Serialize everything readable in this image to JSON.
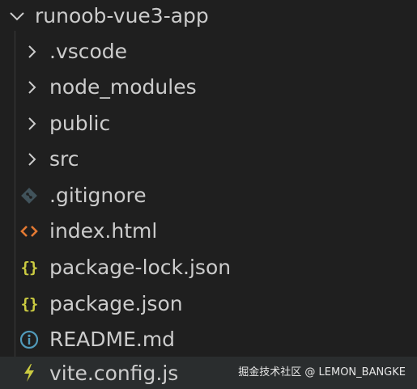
{
  "explorer": {
    "root": {
      "label": "runoob-vue3-app",
      "icon": "chevron-down-icon"
    },
    "items": [
      {
        "label": ".vscode",
        "kind": "folder",
        "icon": "chevron-right-icon"
      },
      {
        "label": "node_modules",
        "kind": "folder",
        "icon": "chevron-right-icon"
      },
      {
        "label": "public",
        "kind": "folder",
        "icon": "chevron-right-icon"
      },
      {
        "label": "src",
        "kind": "folder",
        "icon": "chevron-right-icon"
      },
      {
        "label": ".gitignore",
        "kind": "file",
        "icon": "git-icon",
        "icon_color": "#41535b"
      },
      {
        "label": "index.html",
        "kind": "file",
        "icon": "html-icon",
        "icon_color": "#e37933"
      },
      {
        "label": "package-lock.json",
        "kind": "file",
        "icon": "json-braces-icon",
        "icon_color": "#cbcb41"
      },
      {
        "label": "package.json",
        "kind": "file",
        "icon": "json-braces-icon",
        "icon_color": "#cbcb41"
      },
      {
        "label": "README.md",
        "kind": "file",
        "icon": "info-icon",
        "icon_color": "#519aba"
      },
      {
        "label": "vite.config.js",
        "kind": "file",
        "icon": "lightning-icon",
        "icon_color": "#cbcb41",
        "selected": true
      }
    ]
  },
  "watermark": "掘金技术社区 @ LEMON_BANGKE",
  "colors": {
    "background": "#1f1f1f",
    "text": "#cccccc",
    "selected_row": "#2a2d2e"
  }
}
